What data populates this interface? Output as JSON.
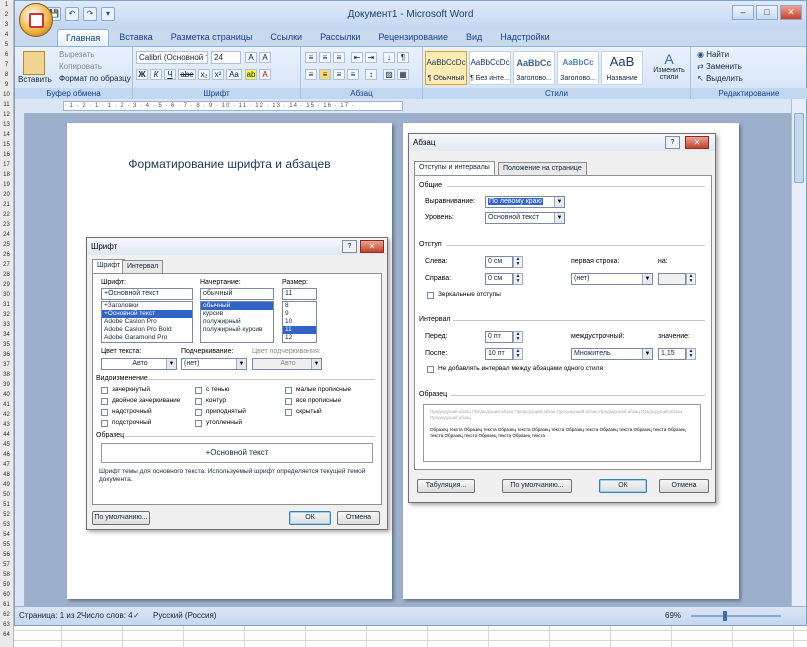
{
  "sheet": {
    "row_numbers": [
      "1",
      "2",
      "3",
      "4",
      "5",
      "6",
      "7",
      "8",
      "9",
      "10",
      "11",
      "12",
      "13",
      "14",
      "15",
      "16",
      "17",
      "18",
      "19",
      "20",
      "21",
      "22",
      "23",
      "24",
      "25",
      "26",
      "27",
      "28",
      "29",
      "30",
      "31",
      "32",
      "33",
      "34",
      "35",
      "36",
      "37",
      "38",
      "39",
      "40",
      "41",
      "42",
      "43",
      "44",
      "45",
      "46",
      "47",
      "48",
      "49",
      "50",
      "51",
      "52",
      "53",
      "54",
      "55",
      "56",
      "57",
      "58",
      "59",
      "60",
      "61",
      "62",
      "63",
      "64"
    ]
  },
  "window": {
    "title": "Документ1 - Microsoft Word",
    "minimize": "–",
    "maximize": "□",
    "close": "✕"
  },
  "qat": {
    "save": "💾",
    "undo": "↶",
    "redo": "↷",
    "customize": "▾"
  },
  "tabs": [
    "Главная",
    "Вставка",
    "Разметка страницы",
    "Ссылки",
    "Рассылки",
    "Рецензирование",
    "Вид",
    "Надстройки"
  ],
  "ribbon": {
    "clipboard": {
      "paste": "Вставить",
      "cut": "Вырезать",
      "copy": "Копировать",
      "format_painter": "Формат по образцу",
      "label": "Буфер обмена"
    },
    "font": {
      "name": "Calibri (Основной те",
      "size": "24",
      "bold": "Ж",
      "italic": "К",
      "underline": "Ч",
      "strike": "abe",
      "sub": "x₂",
      "sup": "x²",
      "case": "Aa",
      "grow": "A",
      "shrink": "A",
      "highlight": "ab",
      "color": "A",
      "label": "Шрифт"
    },
    "paragraph": {
      "label": "Абзац"
    },
    "styles": {
      "items": [
        {
          "preview": "AaBbCcDc",
          "name": "¶ Обычный"
        },
        {
          "preview": "AaBbCcDc",
          "name": "¶ Без инте..."
        },
        {
          "preview": "AaBbCc",
          "name": "Заголово..."
        },
        {
          "preview": "AaBbCc",
          "name": "Заголово..."
        },
        {
          "preview": "AaB",
          "name": "Название"
        }
      ],
      "change": "Изменить стили",
      "label": "Стили"
    },
    "editing": {
      "find": "Найти",
      "replace": "Заменить",
      "select": "Выделить",
      "label": "Редактирование"
    }
  },
  "ruler": {
    "marks": "· 1 · 2 · 1 · 1 · 2 · 3 · 4 · 5 · 6 · 7 · 8 · 9 · 10 · 11 · 12 · 13 · 14 · 15 · 16 · 17 ·"
  },
  "page1": {
    "heading": "Форматирование шрифта и абзацев"
  },
  "font_dialog": {
    "title": "Шрифт",
    "help": "?",
    "close": "✕",
    "tabs": [
      "Шрифт",
      "Интервал"
    ],
    "font_label": "Шрифт:",
    "font_value": "+Основной текст",
    "font_list": [
      "+Заголовки",
      "+Основной текст",
      "Adobe Caslon Pro",
      "Adobe Caslon Pro Bold",
      "Adobe Garamond Pro"
    ],
    "style_label": "Начертание:",
    "style_value": "обычный",
    "style_list": [
      "обычный",
      "курсив",
      "полужирный",
      "полужирный курсив"
    ],
    "size_label": "Размер:",
    "size_value": "11",
    "size_list": [
      "8",
      "9",
      "10",
      "11",
      "12"
    ],
    "color_label": "Цвет текста:",
    "color_value": "Авто",
    "underline_label": "Подчеркивание:",
    "underline_value": "(нет)",
    "underline_color_label": "Цвет подчеркивания:",
    "underline_color_value": "Авто",
    "effects_label": "Видоизменение",
    "effects": [
      "зачеркнутый",
      "двойное зачеркивание",
      "надстрочный",
      "подстрочный",
      "с тенью",
      "контур",
      "приподнятый",
      "утопленный",
      "малые прописные",
      "все прописные",
      "скрытый"
    ],
    "sample_label": "Образец",
    "sample_text": "+Основной текст",
    "description": "Шрифт темы для основного текста. Используемый шрифт определяется текущей темой документа.",
    "default_btn": "По умолчанию...",
    "ok_btn": "ОК",
    "cancel_btn": "Отмена"
  },
  "para_dialog": {
    "title": "Абзац",
    "help": "?",
    "close": "✕",
    "tabs": [
      "Отступы и интервалы",
      "Положение на странице"
    ],
    "general_label": "Общие",
    "alignment_label": "Выравнивание:",
    "alignment_value": "По левому краю",
    "level_label": "Уровень:",
    "level_value": "Основной текст",
    "indent_label": "Отступ",
    "left_label": "Слева:",
    "left_value": "0 см",
    "right_label": "Справа:",
    "right_value": "0 см",
    "first_line_label": "первая строка:",
    "first_line_value": "(нет)",
    "by_label": "на:",
    "by_value": "",
    "mirror_label": "Зеркальные отступы",
    "spacing_label": "Интервал",
    "before_label": "Перед:",
    "before_value": "0 пт",
    "after_label": "После:",
    "after_value": "10 пт",
    "line_label": "междустрочный:",
    "line_value": "Множитель",
    "value_label": "значение:",
    "value_value": "1,15",
    "no_space_label": "Не добавлять интервал между абзацами одного стиля",
    "preview_label": "Образец",
    "preview_prev": "Предыдущий абзац Предыдущий абзац Предыдущий абзац Предыдущий абзац Предыдущий абзац Предыдущий абзац Предыдущий абзац",
    "preview_sample": "Образец текста Образец текста Образец текста Образец текста Образец текста Образец текста Образец текста Образец текста Образец текста Образец текста Образец текста",
    "tabs_btn": "Табуляция...",
    "default_btn": "По умолчанию...",
    "ok_btn": "ОК",
    "cancel_btn": "Отмена"
  },
  "status": {
    "page": "Страница: 1 из 2",
    "words": "Число слов: 4",
    "lang": "Русский (Россия)",
    "zoom": "69%"
  }
}
